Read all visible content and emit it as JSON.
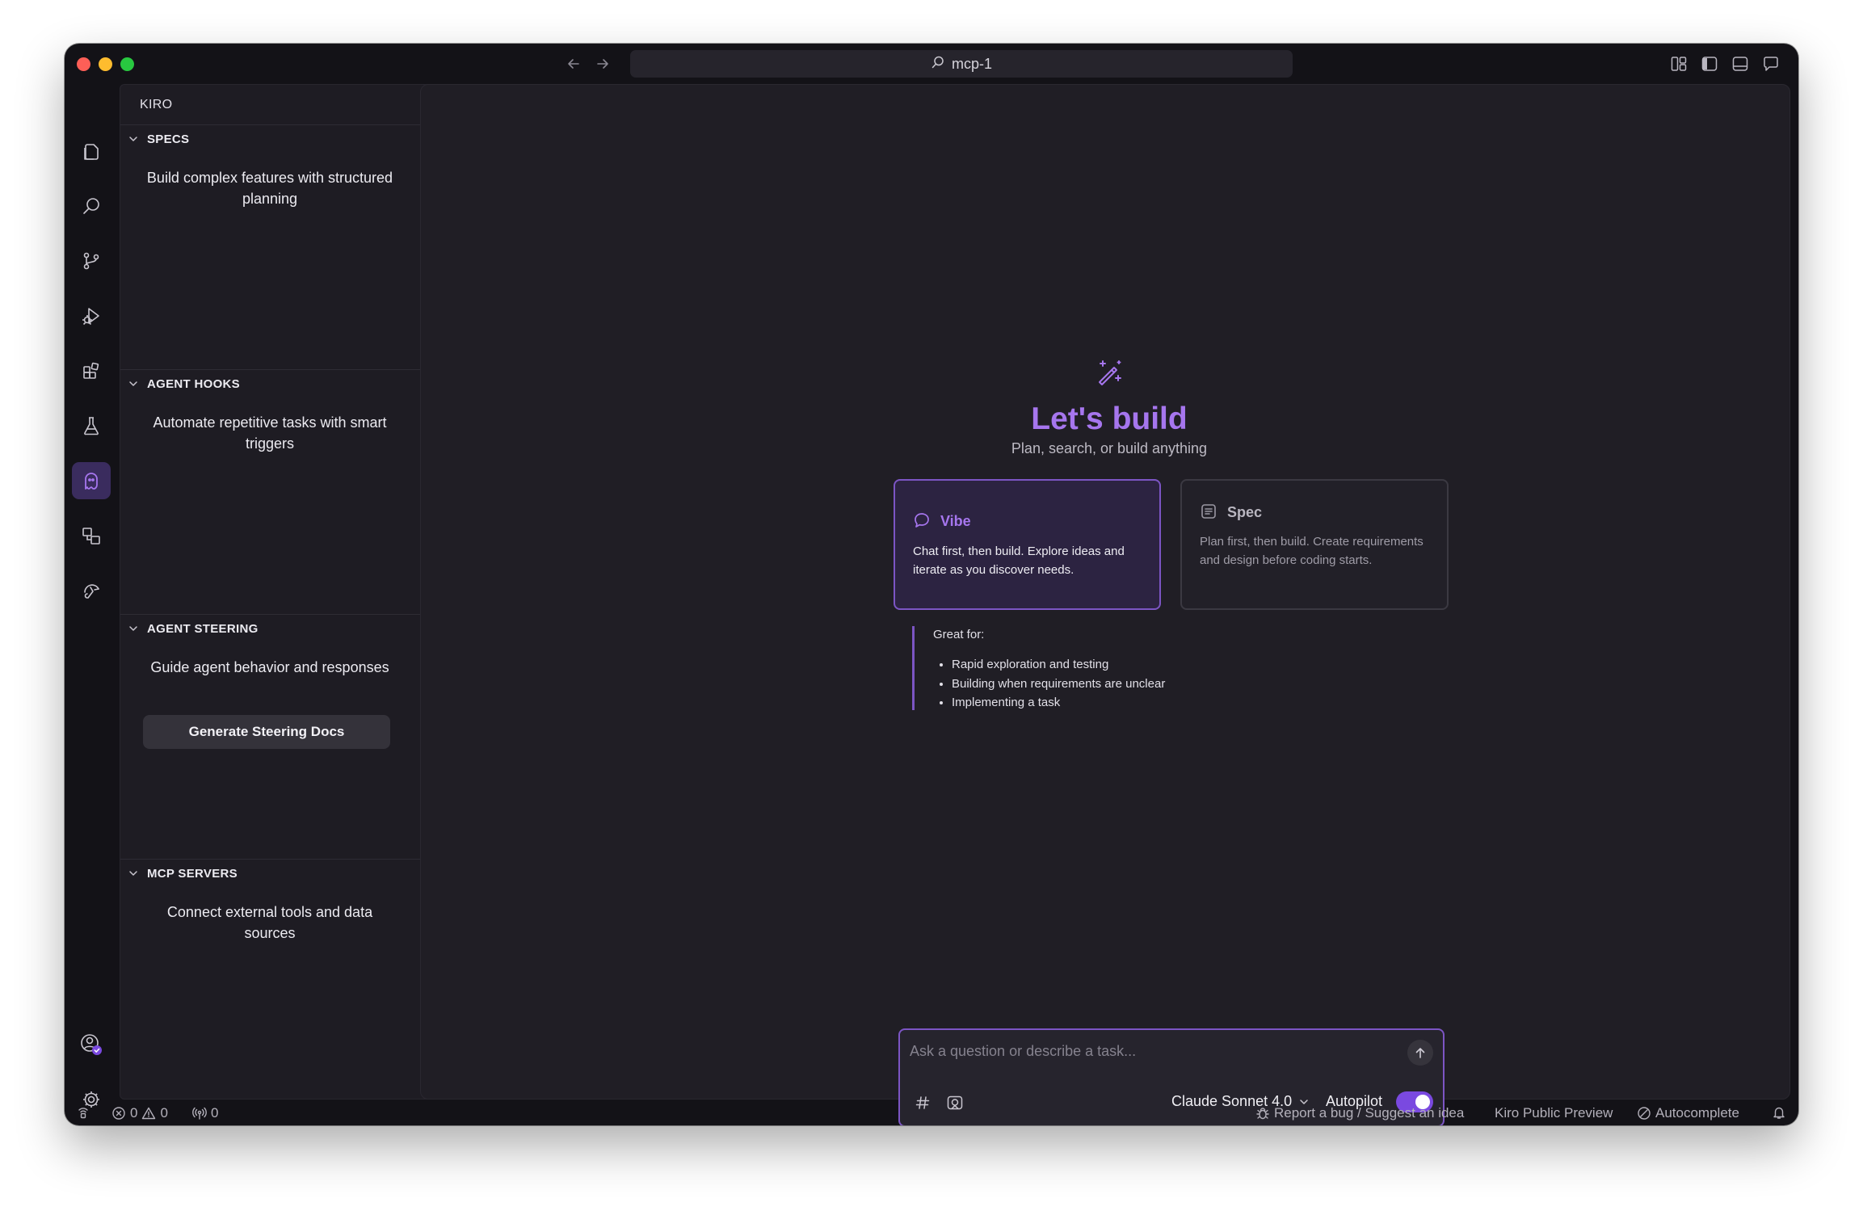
{
  "window": {
    "title": "mcp-1"
  },
  "titlebar": {
    "icons": [
      "back-arrow-icon",
      "forward-arrow-icon",
      "search-icon",
      "layout-customize-icon",
      "toggle-sidebar-icon",
      "toggle-panel-icon",
      "chat-icon"
    ]
  },
  "activity_bar": {
    "items": [
      "explorer-icon",
      "search-icon",
      "source-control-icon",
      "run-debug-icon",
      "extensions-icon",
      "testing-icon",
      "kiro-ghost-icon",
      "remote-explorer-icon",
      "custom-tool-icon"
    ],
    "active": "kiro-ghost-icon",
    "bottom": [
      "account-icon",
      "settings-gear-icon"
    ]
  },
  "sidebar": {
    "title": "KIRO",
    "sections": [
      {
        "title": "SPECS",
        "description": "Build complex features with structured planning"
      },
      {
        "title": "AGENT HOOKS",
        "description": "Automate repetitive tasks with smart triggers"
      },
      {
        "title": "AGENT STEERING",
        "description": "Guide agent behavior and responses",
        "button": "Generate Steering Docs"
      },
      {
        "title": "MCP SERVERS",
        "description": "Connect external tools and data sources"
      }
    ]
  },
  "hero": {
    "title": "Let's build",
    "subtitle": "Plan, search, or build anything"
  },
  "modes": {
    "vibe": {
      "title": "Vibe",
      "description": "Chat first, then build. Explore ideas and iterate as you discover needs.",
      "selected": true
    },
    "spec": {
      "title": "Spec",
      "description": "Plan first, then build. Create requirements and design before coding starts.",
      "selected": false
    }
  },
  "great_for": {
    "title": "Great for:",
    "items": [
      "Rapid exploration and testing",
      "Building when requirements are unclear",
      "Implementing a task"
    ]
  },
  "chat": {
    "placeholder": "Ask a question or describe a task...",
    "model": "Claude Sonnet 4.0",
    "autopilot_label": "Autopilot",
    "autopilot_on": true
  },
  "statusbar": {
    "errors": "0",
    "warnings": "0",
    "ports": "0",
    "report": "Report a bug / Suggest an idea",
    "preview": "Kiro Public Preview",
    "autocomplete": "Autocomplete"
  },
  "colors": {
    "accent": "#a676ee",
    "accent_border": "#7c55c4",
    "window_bg": "#131217",
    "main_bg": "#201e25",
    "sidebar_bg": "#1e1c23"
  }
}
